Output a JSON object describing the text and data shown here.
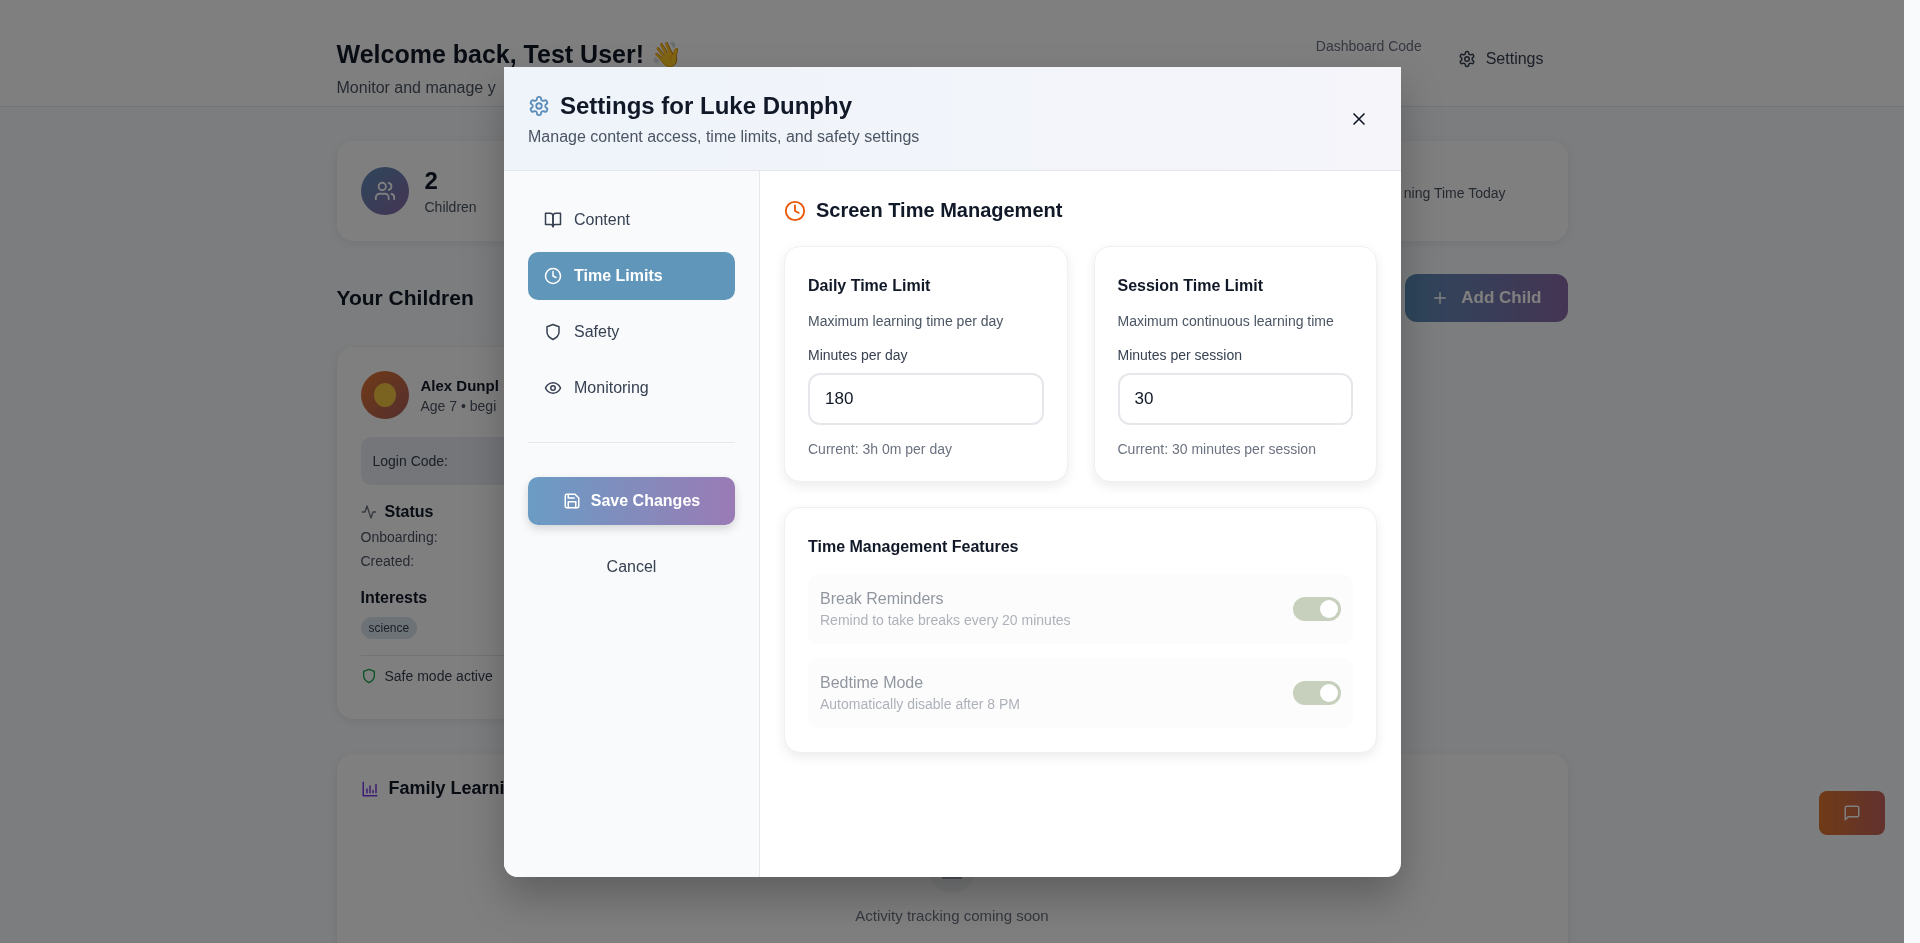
{
  "page": {
    "greeting": "Welcome back, Test User! 👋",
    "subtitle": "Monitor and manage y",
    "dashboard_code_label": "Dashboard Code",
    "settings_button": "Settings"
  },
  "stats": [
    {
      "value": "2",
      "label": "Children"
    },
    {
      "label": "ning Time Today"
    }
  ],
  "children_section": {
    "title": "Your Children",
    "add_button": "Add Child"
  },
  "child_card": {
    "name": "Alex Dunpl",
    "details": "Age 7 • begi",
    "login_code_label": "Login Code:",
    "status_title": "Status",
    "status_rows": [
      "Onboarding:",
      "Created:"
    ],
    "interests_title": "Interests",
    "interests": [
      "science"
    ],
    "safe_mode": "Safe mode active"
  },
  "family_card": {
    "title": "Family Learni",
    "empty_text": "Activity tracking coming soon"
  },
  "modal": {
    "title": "Settings for Luke Dunphy",
    "subtitle": "Manage content access, time limits, and safety settings",
    "nav": [
      {
        "label": "Content",
        "selected": false
      },
      {
        "label": "Time Limits",
        "selected": true
      },
      {
        "label": "Safety",
        "selected": false
      },
      {
        "label": "Monitoring",
        "selected": false
      }
    ],
    "save_button": "Save Changes",
    "cancel_button": "Cancel",
    "section_title": "Screen Time Management",
    "limits": [
      {
        "title": "Daily Time Limit",
        "description": "Maximum learning time per day",
        "field_label": "Minutes per day",
        "value": "180",
        "current": "Current: 3h 0m per day"
      },
      {
        "title": "Session Time Limit",
        "description": "Maximum continuous learning time",
        "field_label": "Minutes per session",
        "value": "30",
        "current": "Current: 30 minutes per session"
      }
    ],
    "features_title": "Time Management Features",
    "features": [
      {
        "title": "Break Reminders",
        "description": "Remind to take breaks every 20 minutes",
        "on": true,
        "disabled": true
      },
      {
        "title": "Bedtime Mode",
        "description": "Automatically disable after 8 PM",
        "on": true,
        "disabled": true
      }
    ]
  }
}
